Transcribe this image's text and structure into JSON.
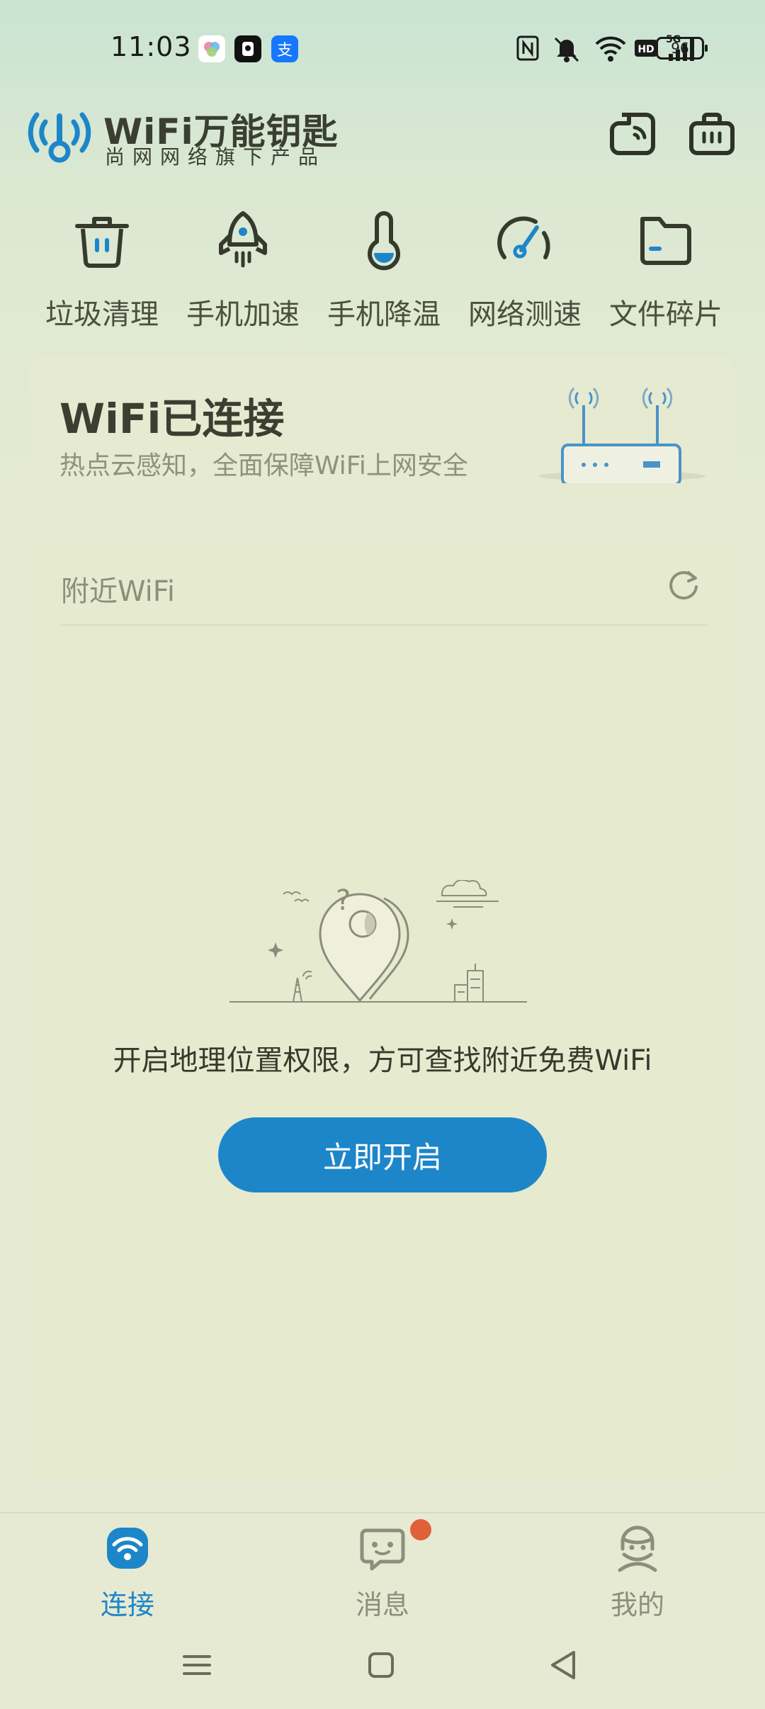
{
  "status_bar": {
    "time": "11:03",
    "battery": "96",
    "apps": [
      "photos-app-icon",
      "camera-app-icon",
      "alipay-app-icon"
    ],
    "alipay_glyph": "支",
    "indicators": [
      "nfc-icon",
      "mute-icon",
      "wifi-icon",
      "hd-icon",
      "5g-signal-icon"
    ]
  },
  "header": {
    "title": "WiFi万能钥匙",
    "subtitle": "尚网网络旗下产品"
  },
  "tools": [
    {
      "label": "垃圾清理",
      "icon": "trash-icon"
    },
    {
      "label": "手机加速",
      "icon": "rocket-icon"
    },
    {
      "label": "手机降温",
      "icon": "thermometer-icon"
    },
    {
      "label": "网络测速",
      "icon": "speedometer-icon"
    },
    {
      "label": "文件碎片",
      "icon": "folder-icon"
    }
  ],
  "connection": {
    "title": "WiFi已连接",
    "subtitle": "热点云感知，全面保障WiFi上网安全"
  },
  "nearby": {
    "title": "附近WiFi",
    "message": "开启地理位置权限，方可查找附近免费WiFi",
    "button": "立即开启"
  },
  "bottom_nav": [
    {
      "label": "连接",
      "icon": "wifi-connect-icon",
      "active": true
    },
    {
      "label": "消息",
      "icon": "message-icon",
      "active": false,
      "badge": true
    },
    {
      "label": "我的",
      "icon": "profile-icon",
      "active": false
    }
  ],
  "colors": {
    "accent": "#1d86c9",
    "badge": "#e0603a",
    "text_dark": "#3a3f31",
    "text_muted": "#8e917e"
  }
}
